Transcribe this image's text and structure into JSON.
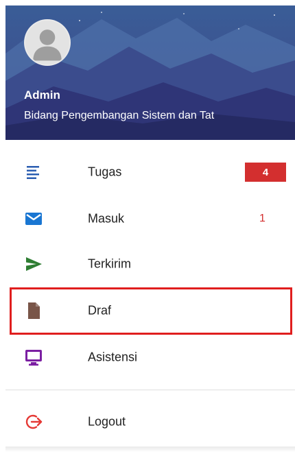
{
  "header": {
    "user_name": "Admin",
    "department": "Bidang Pengembangan Sistem dan Tat"
  },
  "menu": {
    "items": [
      {
        "label": "Tugas",
        "icon": "list-icon",
        "badge": "4",
        "color": "#2a5db0"
      },
      {
        "label": "Masuk",
        "icon": "mail-icon",
        "count": "1",
        "color": "#1976d2"
      },
      {
        "label": "Terkirim",
        "icon": "send-icon",
        "color": "#2e7d32"
      },
      {
        "label": "Draf",
        "icon": "document-icon",
        "color": "#795548"
      },
      {
        "label": "Asistensi",
        "icon": "monitor-icon",
        "color": "#7b1fa2"
      }
    ],
    "logout": {
      "label": "Logout",
      "icon": "logout-icon",
      "color": "#e53935"
    }
  },
  "colors": {
    "badge": "#d32f2f",
    "highlight": "#e01e1e",
    "header_bg": "#2b2f6d"
  }
}
